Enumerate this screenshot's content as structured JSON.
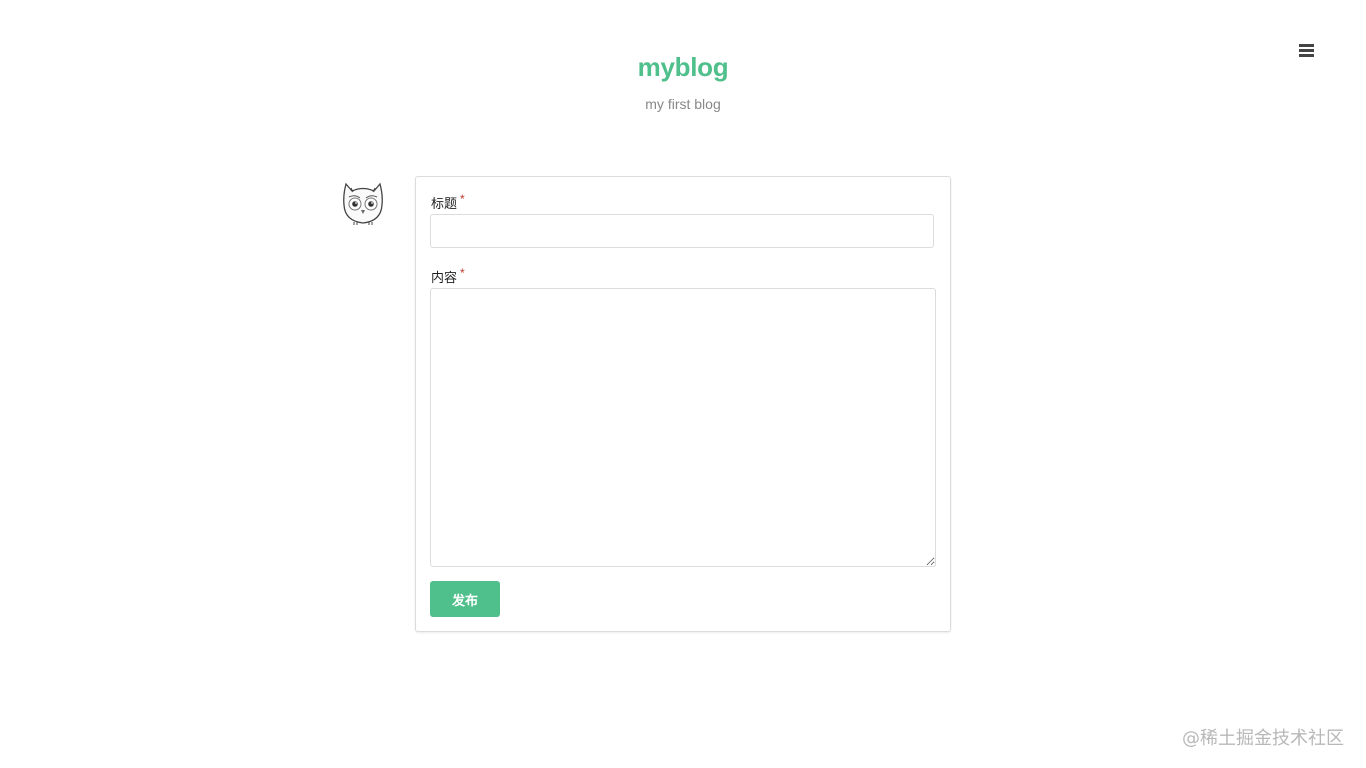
{
  "header": {
    "title": "myblog",
    "subtitle": "my first blog",
    "menu_icon": "hamburger-menu-icon"
  },
  "colors": {
    "brand": "#4fbf8b",
    "required": "#c0392b",
    "border": "#dcdcdc",
    "subtitle": "#888888"
  },
  "avatar": {
    "icon": "owl-avatar-icon"
  },
  "form": {
    "title_label": "标题",
    "title_required": "*",
    "title_value": "",
    "title_placeholder": "",
    "content_label": "内容",
    "content_required": "*",
    "content_value": "",
    "content_placeholder": "",
    "submit_label": "发布"
  },
  "watermark": {
    "text": "@稀土掘金技术社区"
  }
}
